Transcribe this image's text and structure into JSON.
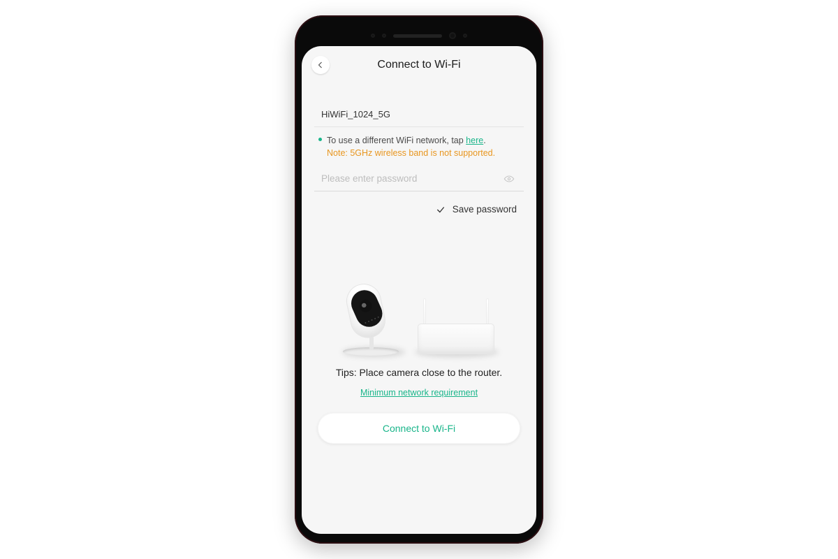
{
  "header": {
    "title": "Connect to Wi-Fi"
  },
  "network": {
    "ssid": "HiWiFi_1024_5G",
    "hint_text": "To use a different WiFi network, tap ",
    "hint_link": "here",
    "hint_period": ".",
    "note": "Note: 5GHz wireless band is not supported."
  },
  "password": {
    "placeholder": "Please enter password",
    "save_label": "Save password"
  },
  "tips": {
    "text": "Tips: Place camera close to the router.",
    "min_req_link": "Minimum network requirement"
  },
  "action": {
    "connect_label": "Connect to Wi-Fi"
  },
  "icons": {
    "back": "chevron-left-icon",
    "eye": "eye-icon",
    "check": "check-icon"
  },
  "colors": {
    "accent": "#19b58a",
    "warning": "#e8961f"
  }
}
